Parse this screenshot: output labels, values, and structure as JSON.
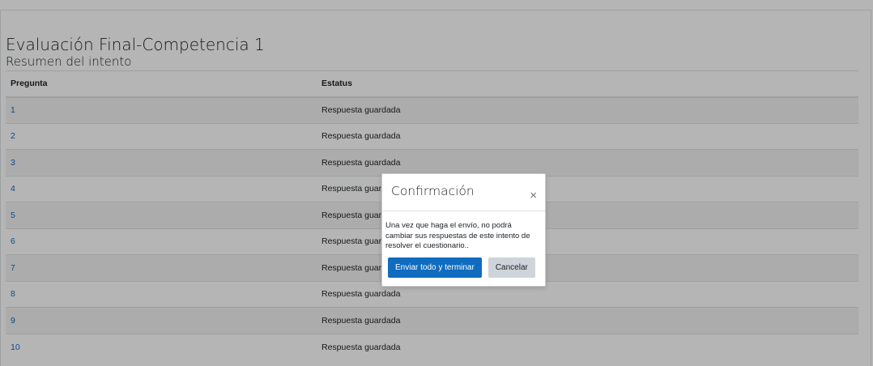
{
  "page": {
    "title": "Evaluación Final-Competencia 1",
    "subtitle": "Resumen del intento"
  },
  "summary_table": {
    "headers": [
      "Pregunta",
      "Estatus"
    ],
    "rows": [
      {
        "question": "1",
        "status": "Respuesta guardada"
      },
      {
        "question": "2",
        "status": "Respuesta guardada"
      },
      {
        "question": "3",
        "status": "Respuesta guardada"
      },
      {
        "question": "4",
        "status": "Respuesta guardada"
      },
      {
        "question": "5",
        "status": "Respuesta guardada"
      },
      {
        "question": "6",
        "status": "Respuesta guardada"
      },
      {
        "question": "7",
        "status": "Respuesta guardada"
      },
      {
        "question": "8",
        "status": "Respuesta guardada"
      },
      {
        "question": "9",
        "status": "Respuesta guardada"
      },
      {
        "question": "10",
        "status": "Respuesta guardada"
      }
    ]
  },
  "modal": {
    "title": "Confirmación",
    "close_icon": "close-icon",
    "close_glyph": "×",
    "body": "Una vez que haga el envío, no podrá cambiar sus respuestas de este intento de resolver el cuestionario..",
    "primary_label": "Enviar todo y terminar",
    "secondary_label": "Cancelar"
  },
  "colors": {
    "link": "#0f6cbf",
    "primary_button": "#0f6cbf",
    "secondary_button": "#ced4da",
    "overlay": "rgba(0,0,0,0.29)"
  }
}
